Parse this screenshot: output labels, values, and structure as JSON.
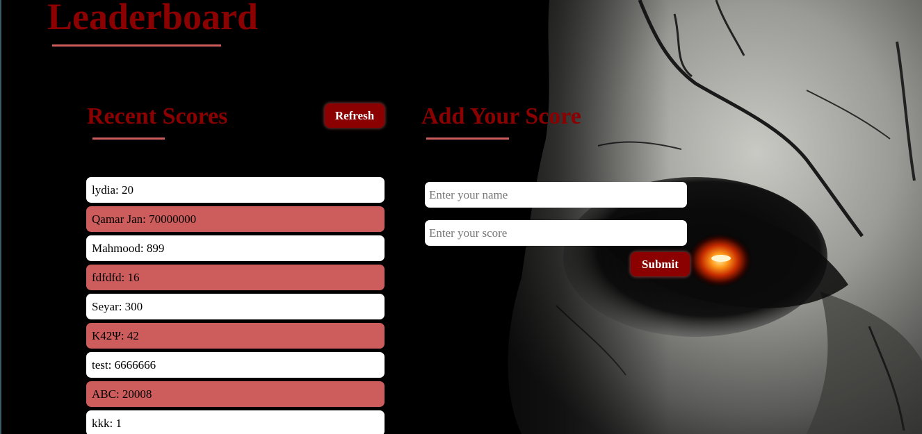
{
  "page": {
    "title": "Leaderboard"
  },
  "recent": {
    "title": "Recent Scores",
    "refresh_label": "Refresh",
    "items": [
      "lydia: 20",
      "Qamar Jan: 70000000",
      "Mahmood: 899",
      "fdfdfd: 16",
      "Seyar: 300",
      "K42Ψ: 42",
      "test: 6666666",
      "ABC: 20008",
      "kkk: 1"
    ]
  },
  "add": {
    "title": "Add Your Score",
    "name_placeholder": "Enter your name",
    "score_placeholder": "Enter your score",
    "submit_label": "Submit"
  },
  "colors": {
    "accent": "#8b0000",
    "row_alt": "#cd5c5c",
    "background": "#000000"
  }
}
